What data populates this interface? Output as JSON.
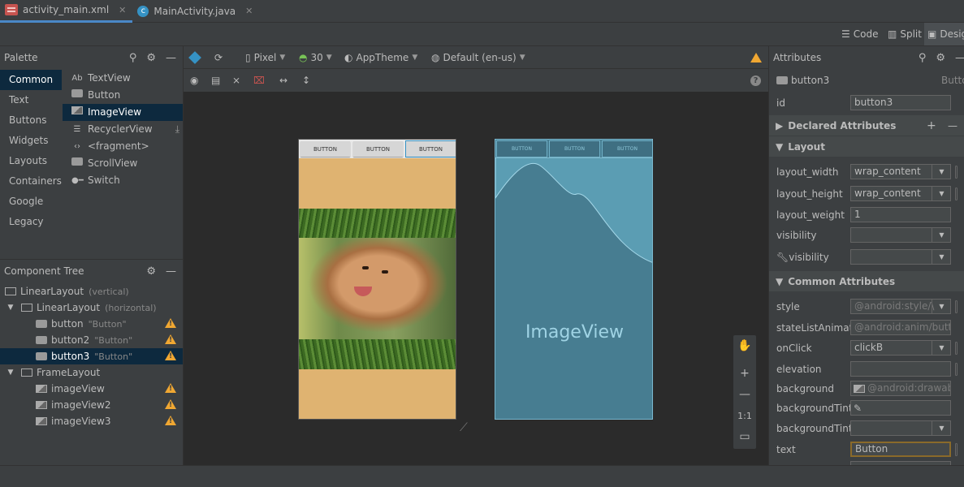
{
  "tabs": [
    {
      "label": "activity_main.xml",
      "icon": "xml-icon"
    },
    {
      "label": "MainActivity.java",
      "icon": "java-class-icon"
    }
  ],
  "view_modes": {
    "code": "Code",
    "split": "Split",
    "design": "Desig"
  },
  "palette": {
    "title": "Palette",
    "categories": [
      "Common",
      "Text",
      "Buttons",
      "Widgets",
      "Layouts",
      "Containers",
      "Google",
      "Legacy"
    ],
    "items": [
      {
        "label": "TextView",
        "icon": "Ab"
      },
      {
        "label": "Button",
        "icon": "button-icon"
      },
      {
        "label": "ImageView",
        "icon": "image-icon"
      },
      {
        "label": "RecyclerView",
        "icon": "list-icon"
      },
      {
        "label": "<fragment>",
        "icon": "code-icon"
      },
      {
        "label": "ScrollView",
        "icon": "scroll-icon"
      },
      {
        "label": "Switch",
        "icon": "switch-icon"
      }
    ]
  },
  "component_tree": {
    "title": "Component Tree",
    "nodes": [
      {
        "label": "LinearLayout",
        "sub": "(vertical)"
      },
      {
        "label": "LinearLayout",
        "sub": "(horizontal)"
      },
      {
        "label": "button",
        "sub": "\"Button\""
      },
      {
        "label": "button2",
        "sub": "\"Button\""
      },
      {
        "label": "button3",
        "sub": "\"Button\""
      },
      {
        "label": "FrameLayout",
        "sub": ""
      },
      {
        "label": "imageView",
        "sub": ""
      },
      {
        "label": "imageView2",
        "sub": ""
      },
      {
        "label": "imageView3",
        "sub": ""
      }
    ]
  },
  "design_toolbar": {
    "device": "Pixel",
    "api": "30",
    "theme": "AppTheme",
    "locale": "Default (en-us)"
  },
  "preview": {
    "button_label": "BUTTON",
    "blueprint_label": "ImageView"
  },
  "zoom_tools": {
    "fit": "1:1"
  },
  "attributes": {
    "title": "Attributes",
    "widget_name": "button3",
    "widget_type": "Butto",
    "id_label": "id",
    "id_value": "button3",
    "sections": {
      "declared": "Declared Attributes",
      "layout": "Layout",
      "common": "Common Attributes"
    },
    "layout_rows": [
      {
        "label": "layout_width",
        "value": "wrap_content"
      },
      {
        "label": "layout_height",
        "value": "wrap_content"
      },
      {
        "label": "layout_weight",
        "value": "1"
      },
      {
        "label": "visibility",
        "value": ""
      },
      {
        "label": "visibility",
        "value": ""
      }
    ],
    "common_rows": [
      {
        "label": "style",
        "value": "@android:style/\\"
      },
      {
        "label": "stateListAnimat...",
        "value": "@android:anim/buttor"
      },
      {
        "label": "onClick",
        "value": "clickB"
      },
      {
        "label": "elevation",
        "value": ""
      },
      {
        "label": "background",
        "value": "@android:drawable"
      },
      {
        "label": "backgroundTint",
        "value": ""
      },
      {
        "label": "backgroundTint...",
        "value": ""
      },
      {
        "label": "text",
        "value": "Button"
      }
    ]
  },
  "colors": {
    "accent": "#4a88c7",
    "selection": "#0d293e",
    "warning": "#f0a732",
    "blueprint": "#477d91",
    "layout_bg": "#dfb371"
  }
}
